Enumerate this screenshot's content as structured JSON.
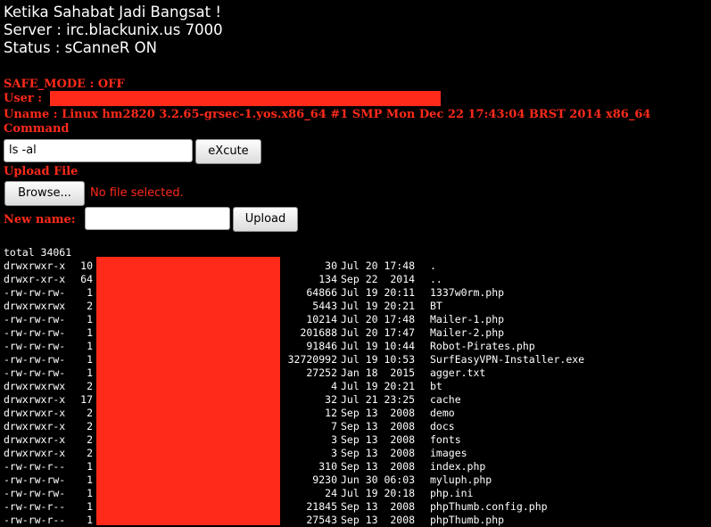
{
  "header": {
    "title": "Ketika Sahabat Jadi Bangsat !",
    "server": "Server : irc.blackunix.us 7000",
    "status": "Status : sCanneR ON"
  },
  "info": {
    "safe_mode": "SAFE_MODE : OFF",
    "user_label": "User :",
    "uname": "Uname : Linux hm2820 3.2.65-grsec-1.yos.x86_64 #1 SMP Mon Dec 22 17:43:04 BRST 2014 x86_64",
    "command_label": "Command"
  },
  "command": {
    "value": "ls -al",
    "execute_label": "eXcute"
  },
  "upload": {
    "heading": "Upload File",
    "browse_label": "Browse...",
    "no_file": "No file selected.",
    "new_name_label": "New name:",
    "new_name_value": "",
    "upload_label": "Upload"
  },
  "colors": {
    "accent_red": "#ff2a1a",
    "background": "#000000",
    "text": "#ffffff"
  },
  "listing": {
    "total": "total 34061",
    "rows": [
      {
        "perm": "drwxrwxr-x",
        "links": "10",
        "size": "30",
        "date": "Jul 20 17:48",
        "name": "."
      },
      {
        "perm": "drwxr-xr-x",
        "links": "64",
        "size": "134",
        "date": "Sep 22  2014",
        "name": ".."
      },
      {
        "perm": "-rw-rw-rw-",
        "links": "1",
        "size": "64866",
        "date": "Jul 19 20:11",
        "name": "1337w0rm.php"
      },
      {
        "perm": "drwxrwxrwx",
        "links": "2",
        "size": "5443",
        "date": "Jul 19 20:21",
        "name": "BT"
      },
      {
        "perm": "-rw-rw-rw-",
        "links": "1",
        "size": "10214",
        "date": "Jul 20 17:48",
        "name": "Mailer-1.php"
      },
      {
        "perm": "-rw-rw-rw-",
        "links": "1",
        "size": "201688",
        "date": "Jul 20 17:47",
        "name": "Mailer-2.php"
      },
      {
        "perm": "-rw-rw-rw-",
        "links": "1",
        "size": "91846",
        "date": "Jul 19 10:44",
        "name": "Robot-Pirates.php"
      },
      {
        "perm": "-rw-rw-rw-",
        "links": "1",
        "size": "32720992",
        "date": "Jul 19 10:53",
        "name": "SurfEasyVPN-Installer.exe"
      },
      {
        "perm": "-rw-rw-rw-",
        "links": "1",
        "size": "27252",
        "date": "Jan 18  2015",
        "name": "agger.txt"
      },
      {
        "perm": "drwxrwxrwx",
        "links": "2",
        "size": "4",
        "date": "Jul 19 20:21",
        "name": "bt"
      },
      {
        "perm": "drwxrwxr-x",
        "links": "17",
        "size": "32",
        "date": "Jul 21 23:25",
        "name": "cache"
      },
      {
        "perm": "drwxrwxr-x",
        "links": "2",
        "size": "12",
        "date": "Sep 13  2008",
        "name": "demo"
      },
      {
        "perm": "drwxrwxr-x",
        "links": "2",
        "size": "7",
        "date": "Sep 13  2008",
        "name": "docs"
      },
      {
        "perm": "drwxrwxr-x",
        "links": "2",
        "size": "3",
        "date": "Sep 13  2008",
        "name": "fonts"
      },
      {
        "perm": "drwxrwxr-x",
        "links": "2",
        "size": "3",
        "date": "Sep 13  2008",
        "name": "images"
      },
      {
        "perm": "-rw-rw-r--",
        "links": "1",
        "size": "310",
        "date": "Sep 13  2008",
        "name": "index.php"
      },
      {
        "perm": "-rw-rw-rw-",
        "links": "1",
        "size": "9230",
        "date": "Jun 30 06:03",
        "name": "myluph.php"
      },
      {
        "perm": "-rw-rw-rw-",
        "links": "1",
        "size": "24",
        "date": "Jul 19 20:18",
        "name": "php.ini"
      },
      {
        "perm": "-rw-rw-r--",
        "links": "1",
        "size": "21845",
        "date": "Sep 13  2008",
        "name": "phpThumb.config.php"
      },
      {
        "perm": "-rw-rw-r--",
        "links": "1",
        "size": "27543",
        "date": "Sep 13  2008",
        "name": "phpThumb.php"
      }
    ]
  }
}
